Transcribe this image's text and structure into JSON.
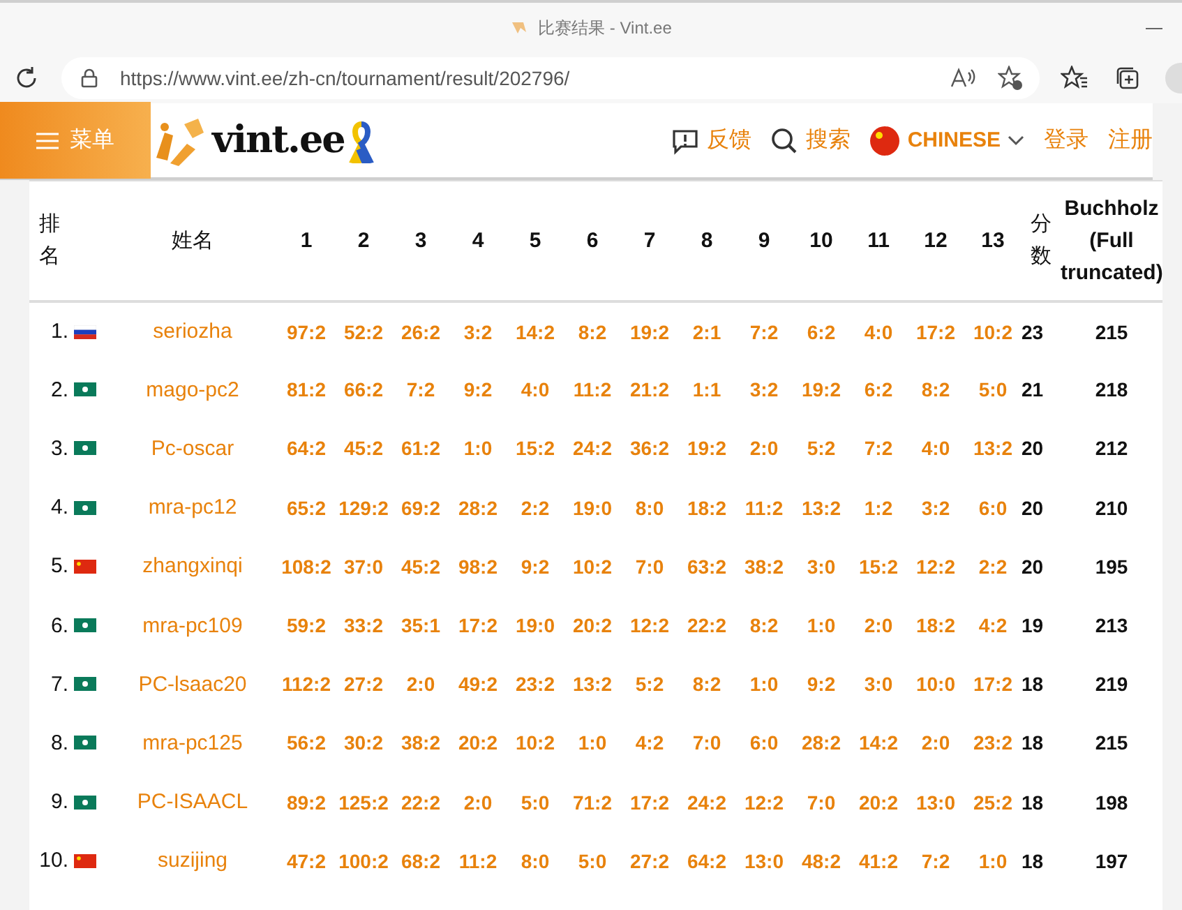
{
  "browser": {
    "title": "比赛结果 - Vint.ee",
    "url": "https://www.vint.ee/zh-cn/tournament/result/202796/"
  },
  "header": {
    "menu": "菜单",
    "logo": "vint.ee",
    "feedback": "反馈",
    "search": "搜索",
    "language": "CHINESE",
    "login": "登录",
    "register": "注册"
  },
  "table": {
    "columns": {
      "rank": "排名",
      "name": "姓名",
      "rounds": [
        "1",
        "2",
        "3",
        "4",
        "5",
        "6",
        "7",
        "8",
        "9",
        "10",
        "11",
        "12",
        "13"
      ],
      "score": "分数",
      "buchholz": "Buchholz (Full truncated)"
    },
    "rows": [
      {
        "rank": "1.",
        "kind": "ru",
        "name": "seriozha",
        "results": [
          "97:2",
          "52:2",
          "26:2",
          "3:2",
          "14:2",
          "8:2",
          "19:2",
          "2:1",
          "7:2",
          "6:2",
          "4:0",
          "17:2",
          "10:2"
        ],
        "score": "23",
        "buchholz": "215"
      },
      {
        "rank": "2.",
        "kind": "mo",
        "name": "mago-pc2",
        "results": [
          "81:2",
          "66:2",
          "7:2",
          "9:2",
          "4:0",
          "11:2",
          "21:2",
          "1:1",
          "3:2",
          "19:2",
          "6:2",
          "8:2",
          "5:0"
        ],
        "score": "21",
        "buchholz": "218"
      },
      {
        "rank": "3.",
        "kind": "mo",
        "name": "Pc-oscar",
        "results": [
          "64:2",
          "45:2",
          "61:2",
          "1:0",
          "15:2",
          "24:2",
          "36:2",
          "19:2",
          "2:0",
          "5:2",
          "7:2",
          "4:0",
          "13:2"
        ],
        "score": "20",
        "buchholz": "212"
      },
      {
        "rank": "4.",
        "kind": "mo",
        "name": "mra-pc12",
        "results": [
          "65:2",
          "129:2",
          "69:2",
          "28:2",
          "2:2",
          "19:0",
          "8:0",
          "18:2",
          "11:2",
          "13:2",
          "1:2",
          "3:2",
          "6:0"
        ],
        "score": "20",
        "buchholz": "210"
      },
      {
        "rank": "5.",
        "kind": "cn",
        "name": "zhangxinqi",
        "results": [
          "108:2",
          "37:0",
          "45:2",
          "98:2",
          "9:2",
          "10:2",
          "7:0",
          "63:2",
          "38:2",
          "3:0",
          "15:2",
          "12:2",
          "2:2"
        ],
        "score": "20",
        "buchholz": "195"
      },
      {
        "rank": "6.",
        "kind": "mo",
        "name": "mra-pc109",
        "results": [
          "59:2",
          "33:2",
          "35:1",
          "17:2",
          "19:0",
          "20:2",
          "12:2",
          "22:2",
          "8:2",
          "1:0",
          "2:0",
          "18:2",
          "4:2"
        ],
        "score": "19",
        "buchholz": "213"
      },
      {
        "rank": "7.",
        "kind": "mo",
        "name": "PC-lsaac20",
        "results": [
          "112:2",
          "27:2",
          "2:0",
          "49:2",
          "23:2",
          "13:2",
          "5:2",
          "8:2",
          "1:0",
          "9:2",
          "3:0",
          "10:0",
          "17:2"
        ],
        "score": "18",
        "buchholz": "219"
      },
      {
        "rank": "8.",
        "kind": "mo",
        "name": "mra-pc125",
        "results": [
          "56:2",
          "30:2",
          "38:2",
          "20:2",
          "10:2",
          "1:0",
          "4:2",
          "7:0",
          "6:0",
          "28:2",
          "14:2",
          "2:0",
          "23:2"
        ],
        "score": "18",
        "buchholz": "215"
      },
      {
        "rank": "9.",
        "kind": "mo",
        "name": "PC-ISAACL",
        "results": [
          "89:2",
          "125:2",
          "22:2",
          "2:0",
          "5:0",
          "71:2",
          "17:2",
          "24:2",
          "12:2",
          "7:0",
          "20:2",
          "13:0",
          "25:2"
        ],
        "score": "18",
        "buchholz": "198"
      },
      {
        "rank": "10.",
        "kind": "cn",
        "name": "suzijing",
        "results": [
          "47:2",
          "100:2",
          "68:2",
          "11:2",
          "8:0",
          "5:0",
          "27:2",
          "64:2",
          "13:0",
          "48:2",
          "41:2",
          "7:2",
          "1:0"
        ],
        "score": "18",
        "buchholz": "197"
      }
    ]
  }
}
